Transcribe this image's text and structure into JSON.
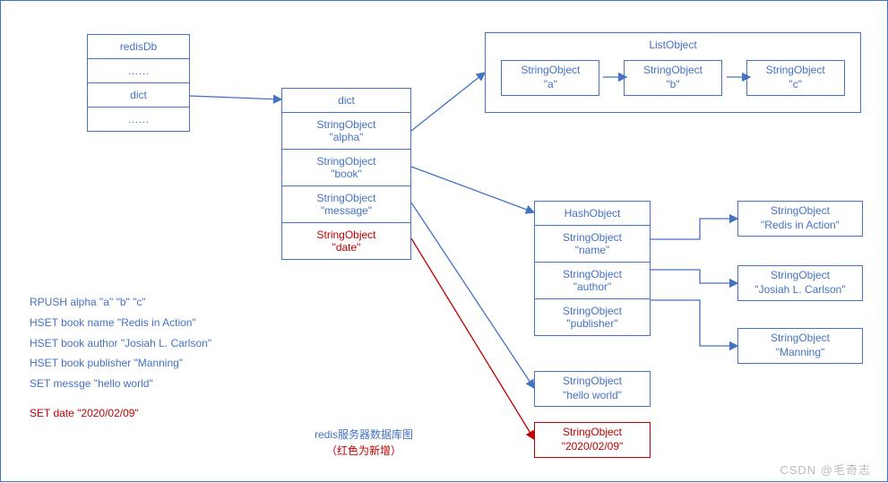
{
  "redisDb": {
    "title": "redisDb",
    "dots1": "……",
    "dict": "dict",
    "dots2": "……"
  },
  "dict": {
    "title": "dict",
    "rows": [
      {
        "l1": "StringObject",
        "l2": "\"alpha\"",
        "red": false
      },
      {
        "l1": "StringObject",
        "l2": "\"book\"",
        "red": false
      },
      {
        "l1": "StringObject",
        "l2": "\"message\"",
        "red": false
      },
      {
        "l1": "StringObject",
        "l2": "\"date\"",
        "red": true
      }
    ]
  },
  "listObject": {
    "title": "ListObject",
    "items": [
      {
        "l1": "StringObject",
        "l2": "\"a\""
      },
      {
        "l1": "StringObject",
        "l2": "\"b\""
      },
      {
        "l1": "StringObject",
        "l2": "\"c\""
      }
    ]
  },
  "hashObject": {
    "title": "HashObject",
    "rows": [
      {
        "l1": "StringObject",
        "l2": "\"name\""
      },
      {
        "l1": "StringObject",
        "l2": "\"author\""
      },
      {
        "l1": "StringObject",
        "l2": "\"publisher\""
      }
    ],
    "values": [
      {
        "l1": "StringObject",
        "l2": "\"Redis in Action\""
      },
      {
        "l1": "StringObject",
        "l2": "\"Josiah L. Carlson\""
      },
      {
        "l1": "StringObject",
        "l2": "\"Manning\""
      }
    ]
  },
  "messageValue": {
    "l1": "StringObject",
    "l2": "\"hello world\""
  },
  "dateValue": {
    "l1": "StringObject",
    "l2": "\"2020/02/09\""
  },
  "commands": {
    "c1": "RPUSH  alpha   \"a\"  \"b\"  \"c\"",
    "c2": "HSET book name   \"Redis in Action\"",
    "c3": "HSET book author  \"Josiah L. Carlson\"",
    "c4": "HSET book publisher   \"Manning\"",
    "c5": "SET messge  \"hello world\"",
    "c6": "SET date  \"2020/02/09\""
  },
  "caption": {
    "line1": "redis服务器数据库图",
    "line2": "（红色为新增）"
  },
  "watermark": "CSDN @毛奇志"
}
